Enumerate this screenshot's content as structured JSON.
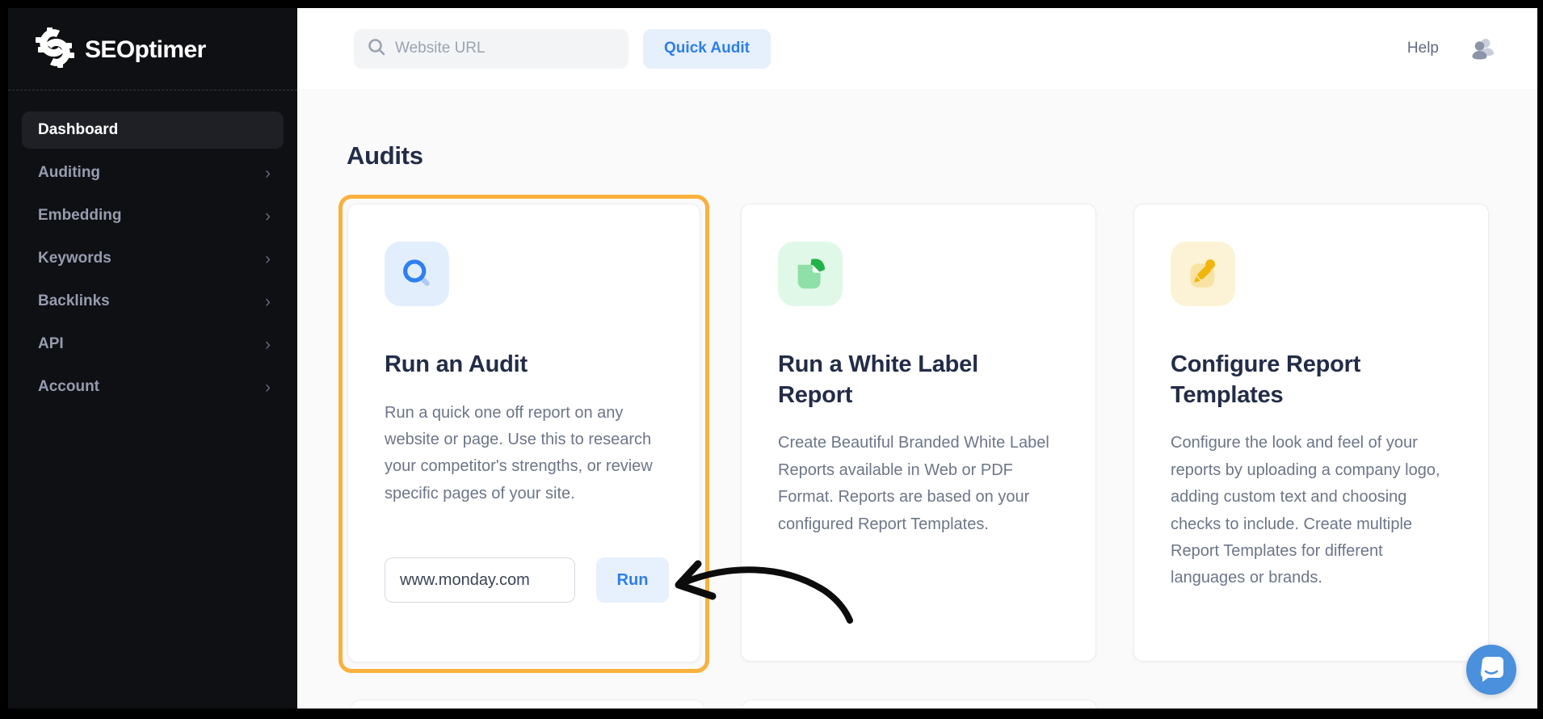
{
  "sidebar": {
    "logo_text": "SEOptimer",
    "items": [
      {
        "label": "Dashboard",
        "active": true,
        "has_chevron": false
      },
      {
        "label": "Auditing",
        "active": false,
        "has_chevron": true
      },
      {
        "label": "Embedding",
        "active": false,
        "has_chevron": true
      },
      {
        "label": "Keywords",
        "active": false,
        "has_chevron": true
      },
      {
        "label": "Backlinks",
        "active": false,
        "has_chevron": true
      },
      {
        "label": "API",
        "active": false,
        "has_chevron": true
      },
      {
        "label": "Account",
        "active": false,
        "has_chevron": true
      }
    ],
    "chevron_glyph": "›"
  },
  "topbar": {
    "search_placeholder": "Website URL",
    "quick_audit_label": "Quick Audit",
    "help_label": "Help"
  },
  "main": {
    "heading": "Audits",
    "cards": [
      {
        "icon": "search-icon",
        "title": "Run an Audit",
        "description": "Run a quick one off report on any website or page. Use this to research your competitor's strengths, or review specific pages of your site.",
        "input_value": "www.monday.com",
        "run_label": "Run",
        "highlighted": true
      },
      {
        "icon": "document-icon",
        "title": "Run a White Label Report",
        "description": "Create Beautiful Branded White Label Reports available in Web or PDF Format. Reports are based on your configured Report Templates."
      },
      {
        "icon": "pencil-icon",
        "title": "Configure Report Templates",
        "description": "Configure the look and feel of your reports by uploading a company logo, adding custom text and choosing checks to include. Create multiple Report Templates for different languages or brands."
      }
    ]
  },
  "colors": {
    "accent_blue": "#2E7FE8",
    "light_blue_bg": "#E7F0FD",
    "highlight_orange": "#F9B13D",
    "sidebar_bg": "#0F1014",
    "heading_navy": "#232C47",
    "body_gray": "#6C7689",
    "green_icon": "#23B24A",
    "gold_icon": "#F1B60C",
    "chat_blue": "#4A90DC"
  }
}
